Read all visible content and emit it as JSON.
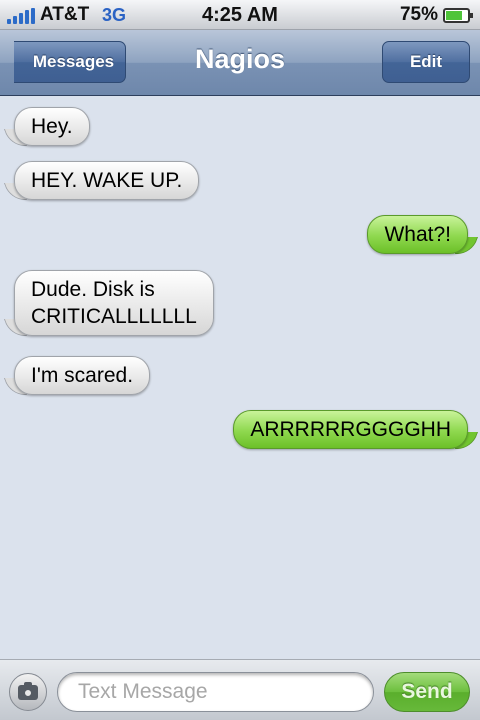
{
  "status_bar": {
    "carrier": "AT&T",
    "network": "3G",
    "time": "4:25 AM",
    "battery_percent": "75%",
    "battery_level": 0.75,
    "signal_icon": "signal-bars-icon",
    "battery_icon": "battery-icon"
  },
  "nav": {
    "back_label": "Messages",
    "title": "Nagios",
    "edit_label": "Edit"
  },
  "messages": [
    {
      "direction": "incoming",
      "text": "Hey."
    },
    {
      "direction": "incoming",
      "text": "HEY. WAKE UP."
    },
    {
      "direction": "outgoing",
      "text": "What?!"
    },
    {
      "direction": "incoming",
      "text": "Dude. Disk is\nCRITICALLLLLLL"
    },
    {
      "direction": "incoming",
      "text": "I'm scared."
    },
    {
      "direction": "outgoing",
      "text": "ARRRRRRGGGGHH"
    }
  ],
  "composer": {
    "camera_icon": "camera-icon",
    "placeholder": "Text Message",
    "value": "",
    "send_label": "Send"
  },
  "colors": {
    "incoming_bubble": "#e9e9e9",
    "outgoing_bubble": "#8ed84e",
    "navbar": "#7a92b4",
    "background": "#dbe2ed"
  }
}
